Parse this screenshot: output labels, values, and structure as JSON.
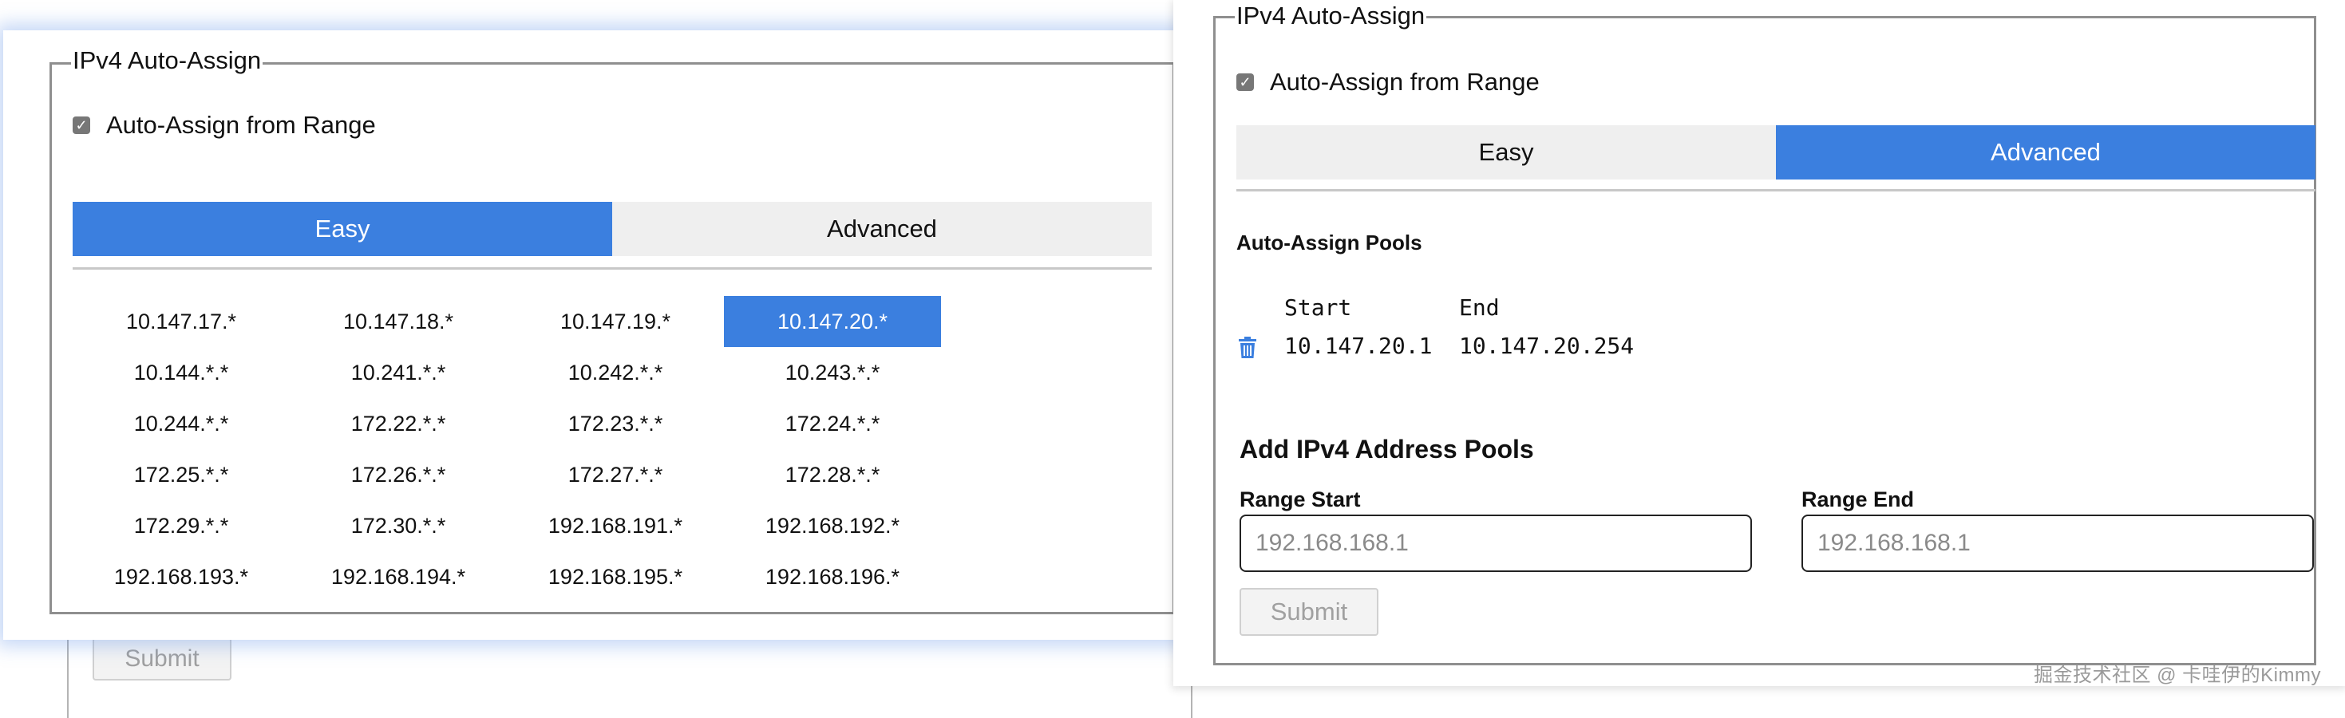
{
  "left_panel": {
    "legend": "IPv4 Auto-Assign",
    "checkbox_label": "Auto-Assign from Range",
    "checkbox_checked": true,
    "tabs": [
      {
        "label": "Easy",
        "active": true
      },
      {
        "label": "Advanced",
        "active": false
      }
    ],
    "ranges": [
      [
        "10.147.17.*",
        "10.147.18.*",
        "10.147.19.*",
        "10.147.20.*"
      ],
      [
        "10.144.*.*",
        "10.241.*.*",
        "10.242.*.*",
        "10.243.*.*"
      ],
      [
        "10.244.*.*",
        "172.22.*.*",
        "172.23.*.*",
        "172.24.*.*"
      ],
      [
        "172.25.*.*",
        "172.26.*.*",
        "172.27.*.*",
        "172.28.*.*"
      ],
      [
        "172.29.*.*",
        "172.30.*.*",
        "192.168.191.*",
        "192.168.192.*"
      ],
      [
        "192.168.193.*",
        "192.168.194.*",
        "192.168.195.*",
        "192.168.196.*"
      ]
    ],
    "selected_range": "10.147.20.*",
    "submit_label": "Submit"
  },
  "right_panel": {
    "legend": "IPv4 Auto-Assign",
    "checkbox_label": "Auto-Assign from Range",
    "checkbox_checked": true,
    "tabs": [
      {
        "label": "Easy",
        "active": false
      },
      {
        "label": "Advanced",
        "active": true
      }
    ],
    "pools_title": "Auto-Assign Pools",
    "pools_header": {
      "start": "Start",
      "end": "End"
    },
    "pools": [
      {
        "start": "10.147.20.1",
        "end": "10.147.20.254"
      }
    ],
    "add_title": "Add IPv4 Address Pools",
    "range_start_label": "Range Start",
    "range_start_placeholder": "192.168.168.1",
    "range_end_label": "Range End",
    "range_end_placeholder": "192.168.168.1",
    "submit_label": "Submit"
  },
  "watermark": "掘金技术社区 @ 卡哇伊的Kimmy",
  "colors": {
    "accent": "#3b7fdf",
    "tab_inactive": "#efefef",
    "border": "#8f8f8f"
  },
  "icons": {
    "checkbox": "checkmark-icon",
    "delete": "trash-icon"
  }
}
